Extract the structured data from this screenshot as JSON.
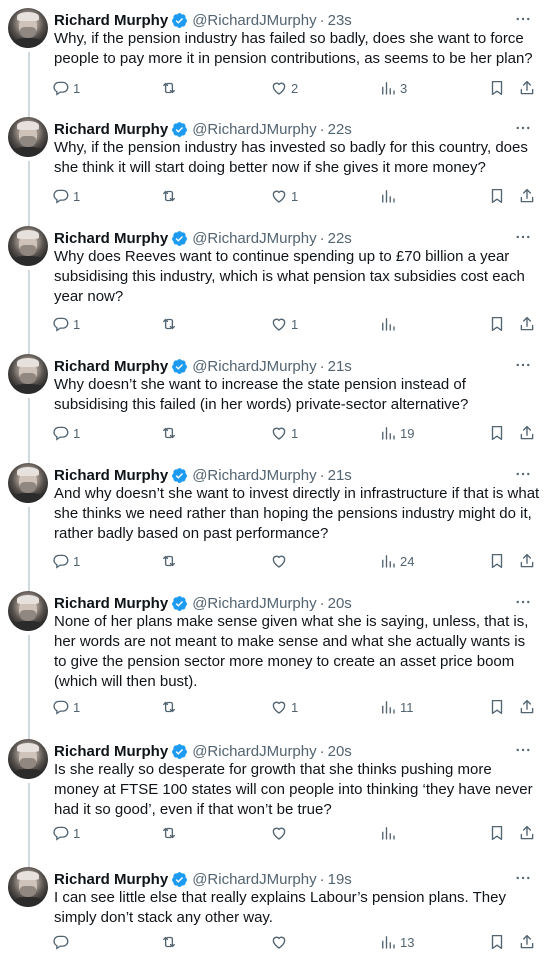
{
  "author": {
    "name": "Richard Murphy",
    "handle": "@RichardJMurphy"
  },
  "separator": "·",
  "tweets": [
    {
      "time": "23s",
      "text": "Why, if the pension industry has failed so badly, does she want to force people to pay more it in pension contributions, as seems to be her plan?",
      "replies": "1",
      "retweets": "",
      "likes": "2",
      "views": "3"
    },
    {
      "time": "22s",
      "text": "Why, if the pension industry has invested so badly for this country, does she think it will start doing better now if she gives it more money?",
      "replies": "1",
      "retweets": "",
      "likes": "1",
      "views": ""
    },
    {
      "time": "22s",
      "text": "Why does Reeves want to continue spending up to £70 billion a year subsidising this industry, which is what pension tax subsidies cost each year now?",
      "replies": "1",
      "retweets": "",
      "likes": "1",
      "views": ""
    },
    {
      "time": "21s",
      "text": "Why doesn’t she want to increase the state pension instead of subsidising this failed (in her words) private-sector alternative?",
      "replies": "1",
      "retweets": "",
      "likes": "1",
      "views": "19"
    },
    {
      "time": "21s",
      "text": "And why doesn’t she want to invest directly in infrastructure if that is what she thinks we need rather than hoping the pensions industry might do it, rather badly based on past performance?",
      "replies": "1",
      "retweets": "",
      "likes": "",
      "views": "24"
    },
    {
      "time": "20s",
      "text": "None of her plans make sense given what she is saying, unless, that is, her words are not meant to make sense and what she actually wants is to give the pension sector more money to create an asset price boom (which will then bust).",
      "replies": "1",
      "retweets": "",
      "likes": "1",
      "views": "11"
    },
    {
      "time": "20s",
      "text": "Is she really so desperate for growth that she thinks pushing more money at FTSE 100 states will con people into thinking ‘they have never had it so good’, even if that won’t be true?",
      "replies": "1",
      "retweets": "",
      "likes": "",
      "views": ""
    },
    {
      "time": "19s",
      "text": "I can see little else that really explains Labour’s pension plans. They simply don’t stack any other way.",
      "replies": "",
      "retweets": "",
      "likes": "",
      "views": "13"
    }
  ],
  "icons": {
    "verified": "verified-badge-icon",
    "more": "more-dots-icon",
    "reply": "reply-bubble-icon",
    "retweet": "retweet-arrows-icon",
    "like": "heart-icon",
    "views": "views-bars-icon",
    "bookmark": "bookmark-icon",
    "share": "share-upload-icon"
  },
  "colors": {
    "text": "#0f1419",
    "secondary": "#536471",
    "verified": "#1d9bf0",
    "thread_line": "#cfd9de"
  }
}
